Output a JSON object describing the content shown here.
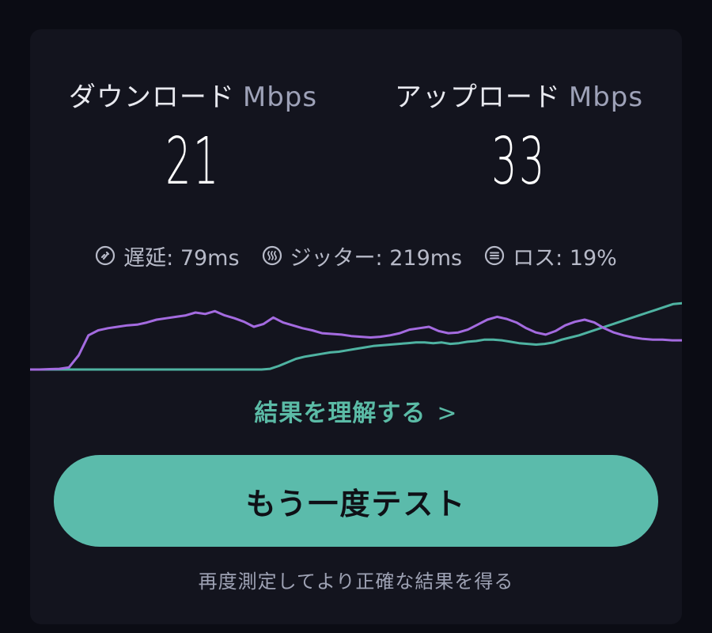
{
  "download": {
    "label": "ダウンロード",
    "unit": "Mbps",
    "value": "21"
  },
  "upload": {
    "label": "アップロード",
    "unit": "Mbps",
    "value": "33"
  },
  "stats": {
    "latency": "遅延: 79ms",
    "jitter": "ジッター: 219ms",
    "loss": "ロス: 19%"
  },
  "link": {
    "label": "結果を理解する",
    "chevron": ">"
  },
  "retest_button": {
    "label": "もう一度テスト"
  },
  "hint": "再度測定してより正確な結果を得る",
  "colors": {
    "accent": "#5bbbab",
    "download_line": "#a46be0",
    "upload_line": "#4fb3a2"
  },
  "chart_data": {
    "type": "line",
    "series": [
      {
        "values": [
          0,
          0,
          0.5,
          1,
          3,
          20,
          48,
          55,
          58,
          60,
          62,
          63,
          66,
          70,
          72,
          74,
          76,
          80,
          78,
          82,
          76,
          72,
          67,
          60,
          64,
          73,
          66,
          62,
          58,
          55,
          51,
          50,
          49,
          47,
          46,
          45,
          46,
          48,
          51,
          56,
          58,
          60,
          54,
          51,
          52,
          56,
          63,
          70,
          74,
          71,
          66,
          58,
          52,
          49,
          54,
          62,
          67,
          70,
          66,
          58,
          52,
          48,
          45,
          43,
          42,
          42,
          41,
          41
        ]
      },
      {
        "values": [
          0,
          0,
          0,
          0,
          0,
          0,
          0,
          0,
          0,
          0,
          0,
          0,
          0,
          0,
          0,
          0,
          0,
          0,
          0,
          0,
          0,
          0,
          0,
          0,
          0,
          0,
          0,
          0,
          1,
          5,
          10,
          15,
          18,
          20,
          22,
          24,
          25,
          27,
          29,
          31,
          33,
          34,
          35,
          36,
          37,
          38,
          38,
          37,
          38,
          36,
          37,
          39,
          40,
          42,
          42,
          41,
          39,
          37,
          36,
          35,
          36,
          38,
          42,
          45,
          48,
          52,
          56,
          60,
          64,
          68,
          72,
          76,
          80,
          84,
          88,
          92,
          93
        ]
      }
    ]
  }
}
